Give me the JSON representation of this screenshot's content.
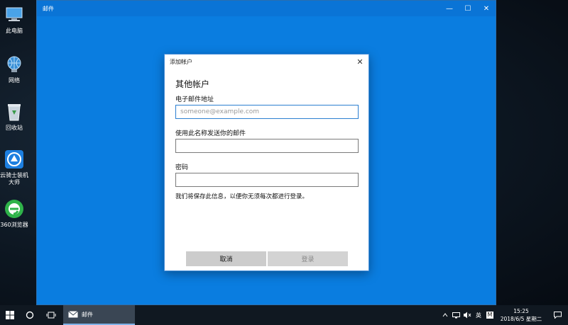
{
  "desktop": {
    "icons": [
      {
        "label": "此电脑",
        "icon": "computer-icon"
      },
      {
        "label": "网络",
        "icon": "network-icon"
      },
      {
        "label": "回收站",
        "icon": "recycle-bin-icon"
      },
      {
        "label": "云骑士装机大师",
        "icon": "yunqishi-app-icon"
      },
      {
        "label": "360浏览器",
        "icon": "360-browser-icon"
      }
    ]
  },
  "mail_window": {
    "title": "邮件",
    "controls": {
      "minimize": "—",
      "maximize": "☐",
      "close": "✕"
    }
  },
  "dialog": {
    "title": "添加帐户",
    "close": "✕",
    "heading": "其他帐户",
    "email_label": "电子邮件地址",
    "email_placeholder": "someone@example.com",
    "name_label": "使用此名称发送你的邮件",
    "password_label": "密码",
    "note": "我们将保存此信息，以便你无须每次都进行登录。",
    "cancel_label": "取消",
    "login_label": "登录"
  },
  "taskbar": {
    "mail_label": "邮件",
    "ime": "英",
    "ime_mode": "M",
    "time": "15:25",
    "date": "2018/6/5 星期二",
    "accent": "#0a7de0"
  }
}
